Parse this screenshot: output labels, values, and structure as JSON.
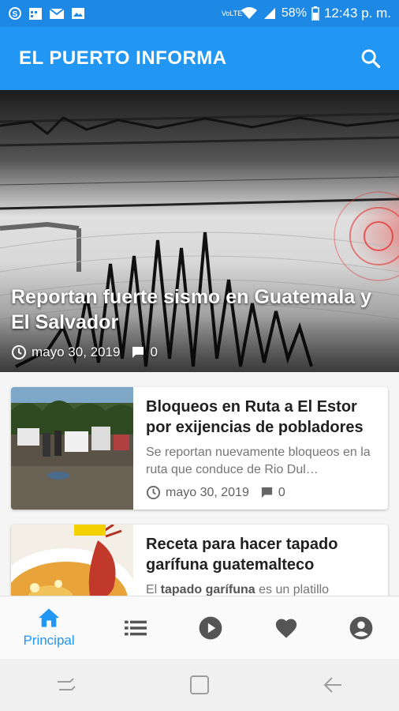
{
  "status_bar": {
    "network": "VoLTE",
    "battery": "58%",
    "time": "12:43 p. m."
  },
  "app_bar": {
    "title": "EL PUERTO INFORMA",
    "search_icon": "search-icon"
  },
  "hero": {
    "title": "Reportan fuerte sismo en Guatemala y El Salvador",
    "date": "mayo 30, 2019",
    "comments": "0"
  },
  "articles": [
    {
      "title": "Bloqueos en Ruta a El Estor por exijencias de pobladores",
      "excerpt": "Se reportan nuevamente bloqueos en la ruta que conduce de Rio Dul…",
      "date": "mayo 30, 2019",
      "comments": "0"
    },
    {
      "title": "Receta para hacer tapado garífuna guatemalteco",
      "excerpt_prefix": "El ",
      "excerpt_bold": "tapado garífuna",
      "excerpt_suffix": " es un platillo"
    }
  ],
  "bottom_nav": {
    "items": [
      {
        "label": "Principal",
        "icon": "home-icon",
        "active": true
      },
      {
        "icon": "list-icon"
      },
      {
        "icon": "play-icon"
      },
      {
        "icon": "heart-icon"
      },
      {
        "icon": "account-icon"
      }
    ]
  },
  "colors": {
    "primary": "#2196f3",
    "status_bar": "#1e88e5"
  }
}
